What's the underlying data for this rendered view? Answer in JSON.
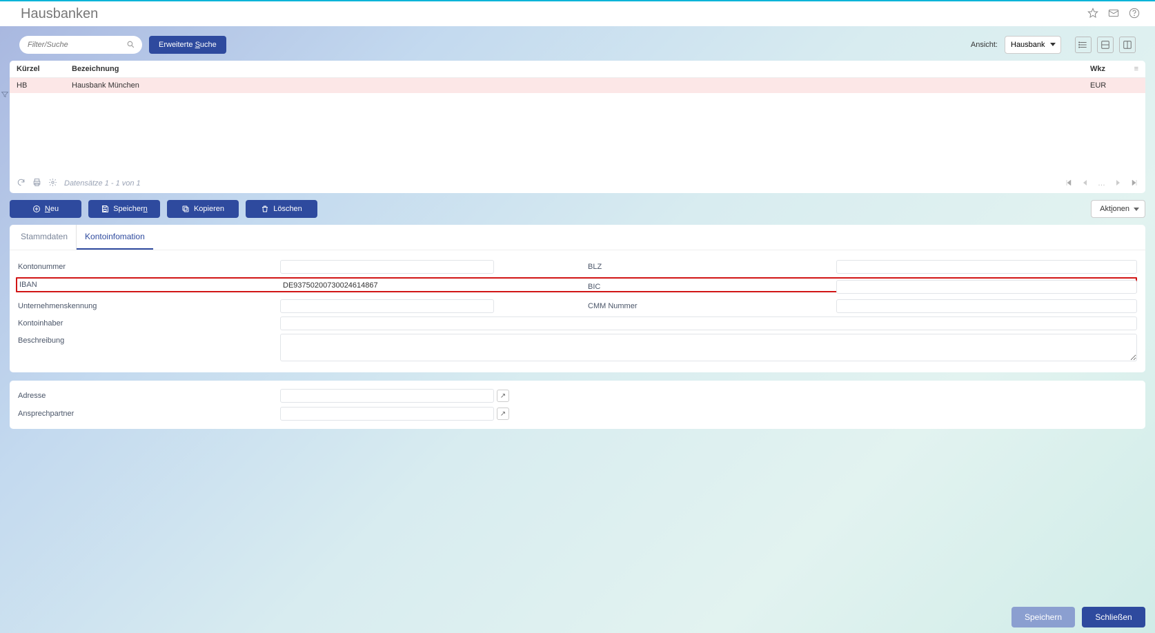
{
  "header": {
    "title": "Hausbanken"
  },
  "toolbar": {
    "search_placeholder": "Filter/Suche",
    "adv_search": "Erweiterte Suche",
    "adv_search_u": "S",
    "view_label": "Ansicht:",
    "view_selected": "Hausbank"
  },
  "grid": {
    "cols": {
      "kuerzel": "Kürzel",
      "bezeichnung": "Bezeichnung",
      "wkz": "Wkz"
    },
    "rows": [
      {
        "kuerzel": "HB",
        "bezeichnung": "Hausbank München",
        "wkz": "EUR"
      }
    ],
    "record_text": "Datensätze 1 - 1 von 1"
  },
  "actions": {
    "neu": "Neu",
    "speichern": "Speichern",
    "kopieren": "Kopieren",
    "loeschen": "Löschen",
    "aktionen": "Aktionen"
  },
  "tabs": {
    "stammdaten": "Stammdaten",
    "kontoinfo": "Kontoinfomation"
  },
  "form": {
    "kontonummer_label": "Kontonummer",
    "kontonummer": "",
    "blz_label": "BLZ",
    "blz": "",
    "iban_label": "IBAN",
    "iban": "DE93750200730024614867",
    "bic_label": "BIC",
    "bic": "",
    "unternehmenskennung_label": "Unternehmenskennung",
    "unternehmenskennung": "",
    "cmm_label": "CMM Nummer",
    "cmm": "",
    "kontoinhaber_label": "Kontoinhaber",
    "kontoinhaber": "",
    "beschreibung_label": "Beschreibung",
    "beschreibung": "",
    "adresse_label": "Adresse",
    "adresse": "",
    "ansprechpartner_label": "Ansprechpartner",
    "ansprechpartner": ""
  },
  "footer": {
    "speichern": "Speichern",
    "schliessen": "Schließen"
  }
}
